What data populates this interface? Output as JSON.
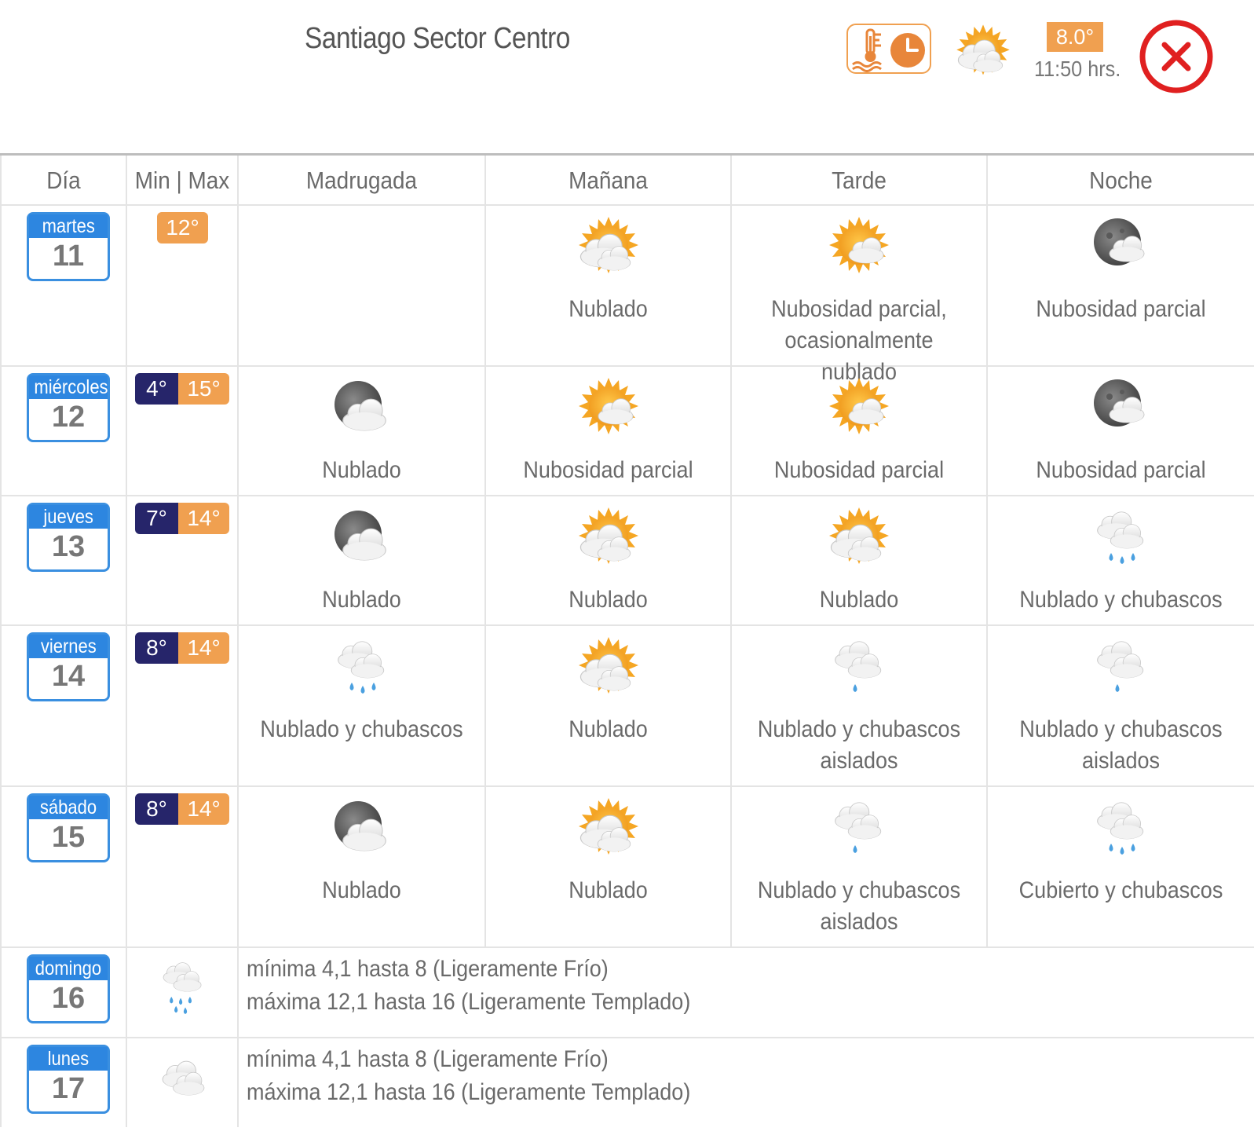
{
  "header": {
    "title": "Santiago Sector Centro",
    "current_temp": "8.0°",
    "current_time": "11:50 hrs."
  },
  "columns": [
    "Día",
    "Min | Max",
    "Madrugada",
    "Mañana",
    "Tarde",
    "Noche"
  ],
  "days": [
    {
      "weekday": "martes",
      "day": "11",
      "min": "",
      "max": "12°",
      "slots": [
        {
          "icon": "",
          "desc": ""
        },
        {
          "icon": "sun-cloud-icon",
          "desc": "Nublado"
        },
        {
          "icon": "sun-small-cloud-icon",
          "desc": "Nubosidad parcial, ocasionalmente nublado"
        },
        {
          "icon": "moon-cloud-icon",
          "desc": "Nubosidad parcial"
        }
      ]
    },
    {
      "weekday": "miércoles",
      "day": "12",
      "min": "4°",
      "max": "15°",
      "slots": [
        {
          "icon": "moon-cloud-big-icon",
          "desc": "Nublado"
        },
        {
          "icon": "sun-small-cloud-icon",
          "desc": "Nubosidad parcial"
        },
        {
          "icon": "sun-small-cloud-icon",
          "desc": "Nubosidad parcial"
        },
        {
          "icon": "moon-cloud-icon",
          "desc": "Nubosidad parcial"
        }
      ]
    },
    {
      "weekday": "jueves",
      "day": "13",
      "min": "7°",
      "max": "14°",
      "slots": [
        {
          "icon": "moon-cloud-big-icon",
          "desc": "Nublado"
        },
        {
          "icon": "sun-cloud-icon",
          "desc": "Nublado"
        },
        {
          "icon": "sun-cloud-icon",
          "desc": "Nublado"
        },
        {
          "icon": "rain-cloud-icon",
          "desc": "Nublado y chubascos"
        }
      ]
    },
    {
      "weekday": "viernes",
      "day": "14",
      "min": "8°",
      "max": "14°",
      "slots": [
        {
          "icon": "rain-cloud-icon",
          "desc": "Nublado y chubascos"
        },
        {
          "icon": "sun-cloud-icon",
          "desc": "Nublado"
        },
        {
          "icon": "rain-cloud-light-icon",
          "desc": "Nublado y chubascos aislados"
        },
        {
          "icon": "rain-cloud-light-icon",
          "desc": "Nublado y chubascos aislados"
        }
      ]
    },
    {
      "weekday": "sábado",
      "day": "15",
      "min": "8°",
      "max": "14°",
      "slots": [
        {
          "icon": "moon-cloud-big-icon",
          "desc": "Nublado"
        },
        {
          "icon": "sun-cloud-icon",
          "desc": "Nublado"
        },
        {
          "icon": "rain-cloud-light-icon",
          "desc": "Nublado y chubascos aislados"
        },
        {
          "icon": "rain-cloud-icon",
          "desc": "Cubierto y chubascos"
        }
      ]
    }
  ],
  "summary_days": [
    {
      "weekday": "domingo",
      "day": "16",
      "icon": "heavy-rain-cloud-icon",
      "line1": "mínima 4,1 hasta 8 (Ligeramente Frío)",
      "line2": "máxima 12,1 hasta 16 (Ligeramente Templado)"
    },
    {
      "weekday": "lunes",
      "day": "17",
      "icon": "cloud-icon",
      "line1": "mínima 4,1 hasta 8 (Ligeramente Frío)",
      "line2": "máxima 12,1 hasta 16 (Ligeramente Templado)"
    }
  ],
  "colors": {
    "accent_orange": "#f0a050",
    "min_navy": "#26256a",
    "calendar_blue": "#2d86e0",
    "close_red": "#e02020"
  }
}
